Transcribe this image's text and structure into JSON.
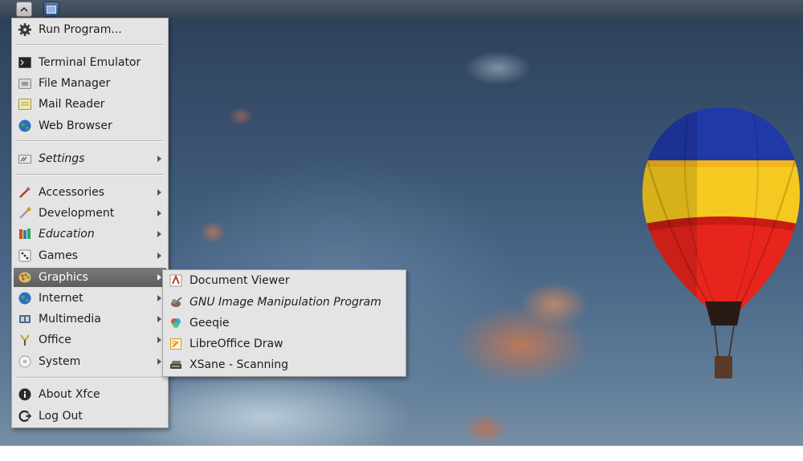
{
  "panel": {
    "apps_button_icon": "menu-chevron-icon",
    "show_desktop_icon": "show-desktop-icon"
  },
  "menu": {
    "items": [
      {
        "label": "Run Program...",
        "icon": "gear-icon"
      },
      {
        "label": "Terminal Emulator",
        "icon": "terminal-icon"
      },
      {
        "label": "File Manager",
        "icon": "file-manager-icon"
      },
      {
        "label": "Mail Reader",
        "icon": "mail-icon"
      },
      {
        "label": "Web Browser",
        "icon": "globe-icon"
      },
      {
        "label": "Settings",
        "icon": "settings-icon",
        "submenu": true
      },
      {
        "label": "Accessories",
        "icon": "accessories-icon",
        "submenu": true
      },
      {
        "label": "Development",
        "icon": "development-icon",
        "submenu": true
      },
      {
        "label": "Education",
        "icon": "education-icon",
        "submenu": true
      },
      {
        "label": "Games",
        "icon": "games-icon",
        "submenu": true
      },
      {
        "label": "Graphics",
        "icon": "palette-icon",
        "submenu": true,
        "selected": true
      },
      {
        "label": "Internet",
        "icon": "globe-icon",
        "submenu": true
      },
      {
        "label": "Multimedia",
        "icon": "multimedia-icon",
        "submenu": true
      },
      {
        "label": "Office",
        "icon": "office-icon",
        "submenu": true
      },
      {
        "label": "System",
        "icon": "system-icon",
        "submenu": true
      },
      {
        "label": "About Xfce",
        "icon": "info-icon"
      },
      {
        "label": "Log Out",
        "icon": "logout-icon"
      }
    ]
  },
  "graphics_submenu": {
    "items": [
      {
        "label": "Document Viewer",
        "icon": "document-viewer-icon"
      },
      {
        "label": "GNU Image Manipulation Program",
        "icon": "gimp-icon"
      },
      {
        "label": "Geeqie",
        "icon": "geeqie-icon"
      },
      {
        "label": "LibreOffice Draw",
        "icon": "libreoffice-draw-icon"
      },
      {
        "label": "XSane - Scanning",
        "icon": "scanner-icon"
      }
    ]
  },
  "colors": {
    "menu_bg": "#e4e4e4",
    "selected_bg": "#6a6a6a",
    "panel_bg": "#404c58"
  }
}
